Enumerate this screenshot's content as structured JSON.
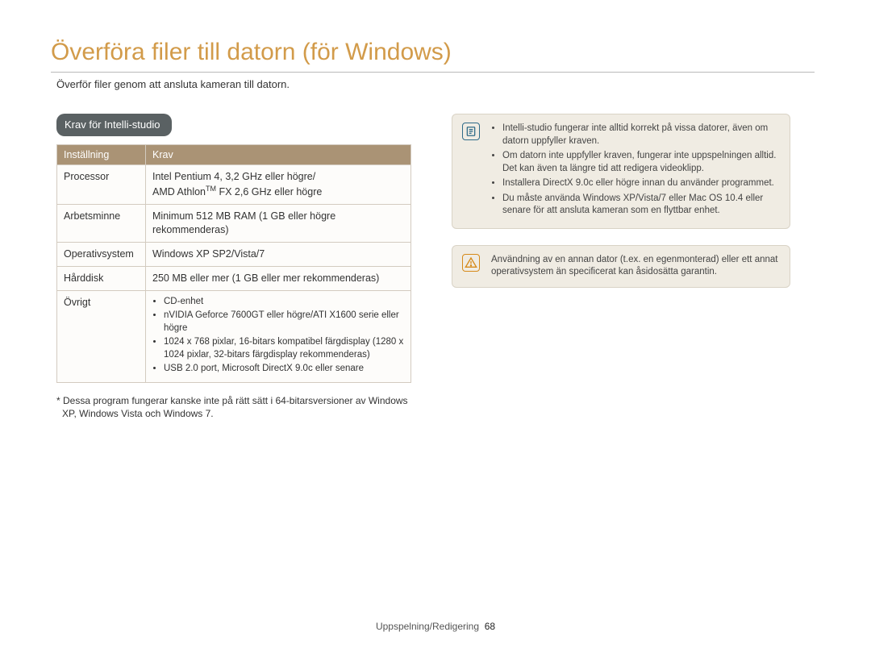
{
  "title": "Överföra filer till datorn (för Windows)",
  "subtitle": "Överför filer genom att ansluta kameran till datorn.",
  "deck_heading": "Krav för Intelli-studio",
  "table": {
    "headers": [
      "Inställning",
      "Krav"
    ],
    "rows": {
      "processor": {
        "label": "Processor",
        "value_line1": "Intel Pentium 4, 3,2 GHz eller högre/",
        "value_line2_pre": "AMD Athlon",
        "value_line2_tm": "TM",
        "value_line2_post": " FX 2,6 GHz eller högre"
      },
      "memory": {
        "label": "Arbetsminne",
        "value": "Minimum 512 MB RAM (1 GB eller högre rekommenderas)"
      },
      "os": {
        "label": "Operativsystem",
        "value": "Windows XP SP2/Vista/7"
      },
      "hdd": {
        "label": "Hårddisk",
        "value": "250 MB eller mer (1 GB eller mer rekommenderas)"
      },
      "other": {
        "label": "Övrigt",
        "items": [
          "CD-enhet",
          "nVIDIA Geforce 7600GT eller högre/ATI X1600 serie eller högre",
          "1024 x 768 pixlar, 16-bitars kompatibel färgdisplay (1280 x 1024 pixlar, 32-bitars färgdisplay rekommenderas)",
          "USB 2.0 port, Microsoft DirectX 9.0c eller senare"
        ]
      }
    }
  },
  "footnote": "* Dessa program fungerar kanske inte på rätt sätt i 64-bitarsversioner av Windows XP, Windows Vista och Windows 7.",
  "note": {
    "items": [
      "Intelli-studio fungerar inte alltid korrekt på vissa datorer, även om datorn uppfyller kraven.",
      "Om datorn inte uppfyller kraven, fungerar inte uppspelningen alltid. Det kan även ta längre tid att redigera videoklipp.",
      "Installera DirectX 9.0c eller högre innan du använder programmet.",
      "Du måste använda Windows XP/Vista/7 eller Mac OS 10.4 eller senare för att ansluta kameran som en flyttbar enhet."
    ]
  },
  "warn": {
    "text": "Användning av en annan dator (t.ex. en egenmonterad) eller ett annat operativsystem än specificerat kan åsidosätta garantin."
  },
  "footer": {
    "section": "Uppspelning/Redigering",
    "page": "68"
  }
}
